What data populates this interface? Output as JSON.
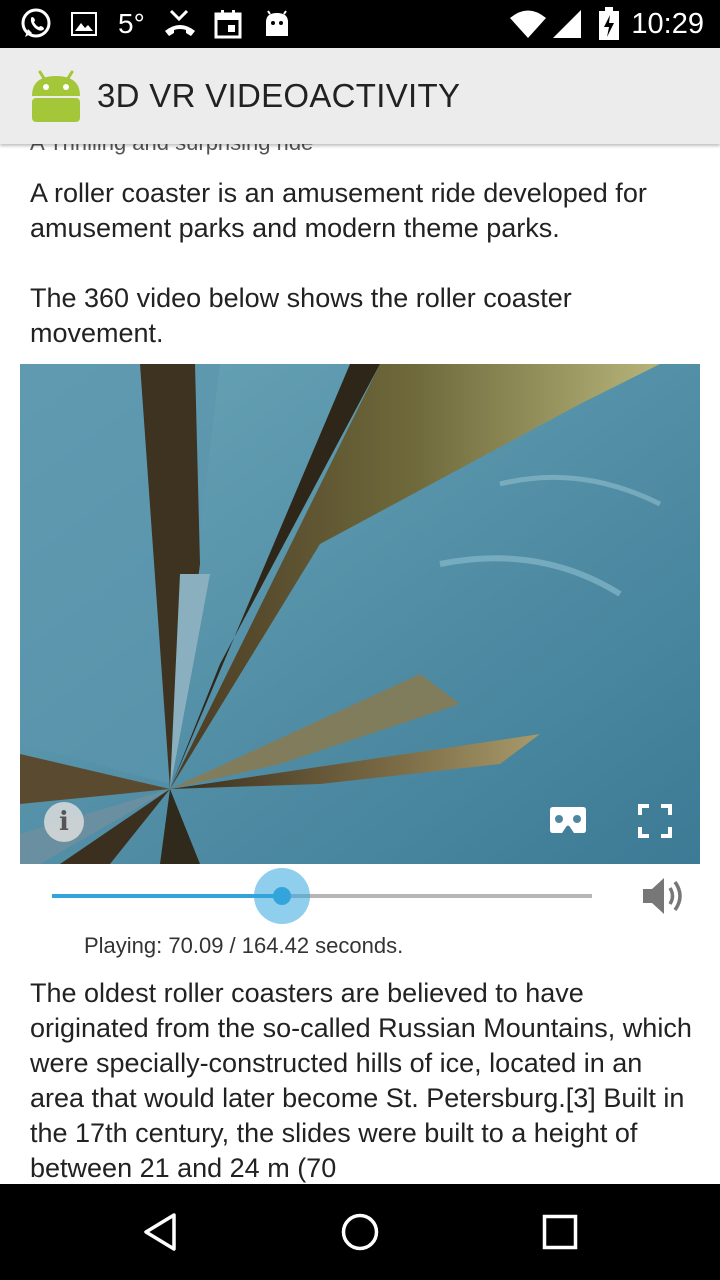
{
  "status_bar": {
    "temperature": "5°",
    "time": "10:29",
    "icons": [
      "whatsapp-icon",
      "image-icon",
      "temperature-text",
      "missed-call-icon",
      "calendar-icon",
      "android-debug-icon",
      "wifi-icon",
      "signal-icon",
      "battery-icon"
    ]
  },
  "action_bar": {
    "title": "3D VR VIDEOACTIVITY",
    "icon": "android-robot-icon"
  },
  "content": {
    "cut_off_line": "A Thrilling and surprising ride",
    "intro_paragraph_1": "A roller coaster is an amusement ride developed for amusement parks and modern theme parks.",
    "intro_paragraph_2": "The 360 video below shows the roller coaster movement.",
    "body_paragraph": "The oldest roller coasters are believed to have originated from the so-called Russian Mountains, which were specially-constructed hills of ice, located in an area that would later become St. Petersburg.[3] Built in the 17th century, the slides were built to a height of between 21 and 24 m (70"
  },
  "video": {
    "controls": [
      "info-icon",
      "cardboard-icon",
      "fullscreen-icon"
    ],
    "seek_fraction": 0.426,
    "status_text": "Playing: 70.09 / 164.42 seconds.",
    "volume_icon": "volume-icon"
  },
  "nav_bar": {
    "buttons": [
      "back-icon",
      "home-icon",
      "recents-icon"
    ]
  },
  "colors": {
    "accent": "#33a5dc",
    "action_bar": "#ececec",
    "android_green": "#a4c639"
  }
}
